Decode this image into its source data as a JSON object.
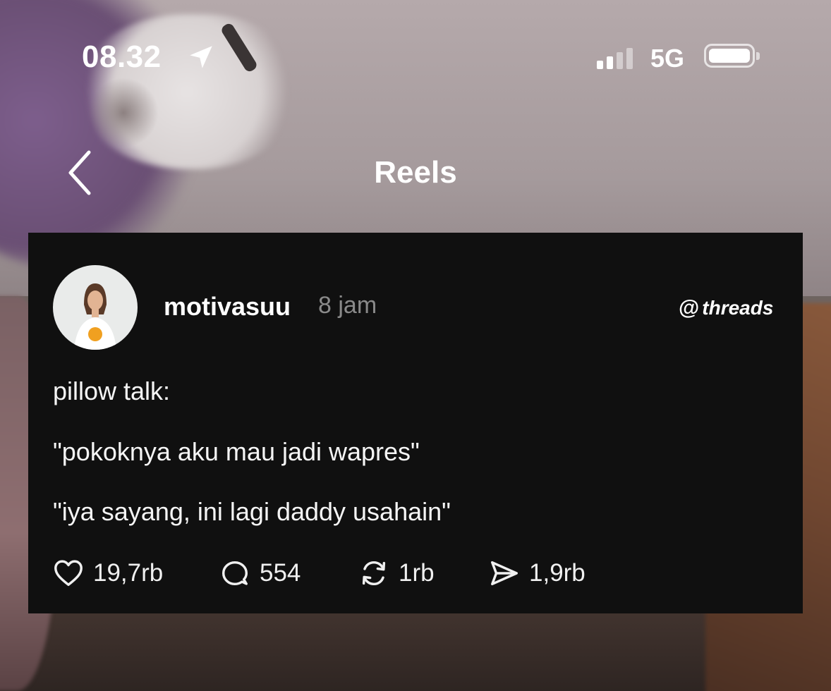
{
  "status_bar": {
    "time": "08.32",
    "network": "5G",
    "icons": [
      "location-arrow-icon",
      "signal-icon",
      "battery-icon"
    ]
  },
  "header": {
    "title": "Reels",
    "back_icon": "chevron-left-icon"
  },
  "post": {
    "username": "motivasuu",
    "time_ago": "8 jam",
    "brand": "threads",
    "lines": [
      "pillow talk:",
      "\"pokoknya aku mau jadi wapres\"",
      "\"iya sayang, ini lagi daddy usahain\""
    ],
    "actions": [
      {
        "icon": "heart-icon",
        "count": "19,7rb"
      },
      {
        "icon": "comment-icon",
        "count": "554"
      },
      {
        "icon": "repost-icon",
        "count": "1rb"
      },
      {
        "icon": "send-icon",
        "count": "1,9rb"
      }
    ]
  },
  "colors": {
    "card_bg": "#101010",
    "muted_text": "#8a8a8a",
    "text": "#ffffff"
  }
}
